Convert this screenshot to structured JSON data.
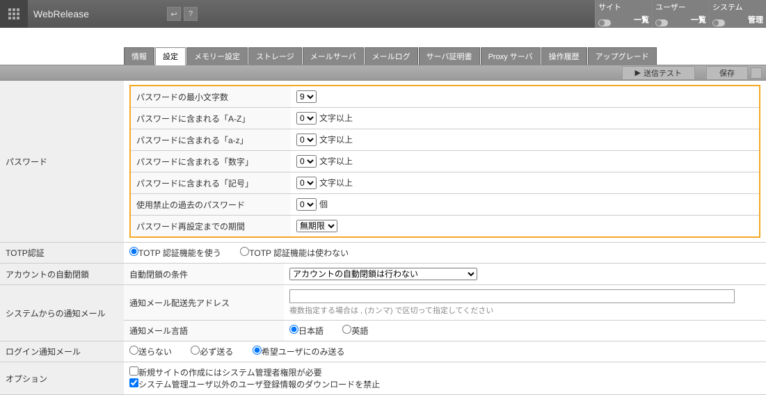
{
  "header": {
    "brand": "WebRelease",
    "boxes": [
      {
        "title": "サイト",
        "sub": "一覧"
      },
      {
        "title": "ユーザー",
        "sub": "一覧"
      },
      {
        "title": "システム",
        "sub": "管理"
      }
    ]
  },
  "tabs": [
    "情報",
    "設定",
    "メモリー設定",
    "ストレージ",
    "メールサーバ",
    "メールログ",
    "サーバ証明書",
    "Proxy サーバ",
    "操作履歴",
    "アップグレード"
  ],
  "active_tab": 1,
  "toolbar": {
    "send_test": "送信テスト",
    "save": "保存"
  },
  "form": {
    "section_password": "パスワード",
    "pw_min_label": "パスワードの最小文字数",
    "pw_min_value": "9",
    "pw_upper_label": "パスワードに含まれる「A-Z」",
    "pw_upper_value": "0",
    "pw_lower_label": "パスワードに含まれる「a-z」",
    "pw_lower_value": "0",
    "pw_digit_label": "パスワードに含まれる「数字」",
    "pw_digit_value": "0",
    "pw_symbol_label": "パスワードに含まれる「記号」",
    "pw_symbol_value": "0",
    "pw_history_label": "使用禁止の過去のパスワード",
    "pw_history_value": "0",
    "pw_period_label": "パスワード再設定までの期間",
    "pw_period_value": "無期限",
    "suffix_chars": "文字以上",
    "suffix_count": "個",
    "section_totp": "TOTP認証",
    "totp_use": "TOTP 認証機能を使う",
    "totp_not_use": "TOTP 認証機能は使わない",
    "section_lockout": "アカウントの自動閉鎖",
    "lockout_label": "自動閉鎖の条件",
    "lockout_value": "アカウントの自動閉鎖は行わない",
    "section_sysmail": "システムからの通知メール",
    "sysmail_addr_label": "通知メール配送先アドレス",
    "sysmail_addr_hint": "複数指定する場合は , (カンマ) で区切って指定してください",
    "sysmail_lang_label": "通知メール言語",
    "lang_ja": "日本語",
    "lang_en": "英語",
    "section_loginmail": "ログイン通知メール",
    "loginmail_none": "送らない",
    "loginmail_always": "必ず送る",
    "loginmail_opt": "希望ユーザにのみ送る",
    "section_option": "オプション",
    "opt_newsite": "新規サイトの作成にはシステム管理者権限が必要",
    "opt_download": "システム管理ユーザ以外のユーザ登録情報のダウンロードを禁止"
  }
}
